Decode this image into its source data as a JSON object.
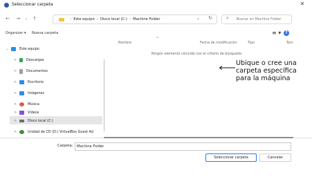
{
  "window": {
    "title": "Seleccionar carpeta"
  },
  "address_bar": {
    "crumbs": [
      "Este equipo",
      "Disco local (C:)",
      "Machine Folder"
    ]
  },
  "search": {
    "placeholder": "Buscar en Machine Folder"
  },
  "commands": {
    "organize": "Organizar ▾",
    "new_folder": "Nueva carpeta"
  },
  "sidebar": {
    "items": [
      {
        "label": "Este equipo",
        "chevron": "⌄",
        "icon": "computer-icon",
        "color": "#2b8ee6"
      },
      {
        "label": "Descargas",
        "chevron": ">",
        "icon": "download-icon",
        "color": "#2fa84f"
      },
      {
        "label": "Documentos",
        "chevron": ">",
        "icon": "document-icon",
        "color": "#9e9e9e"
      },
      {
        "label": "Escritorio",
        "chevron": ">",
        "icon": "desktop-icon",
        "color": "#2b8ee6"
      },
      {
        "label": "Imágenes",
        "chevron": ">",
        "icon": "pictures-icon",
        "color": "#2b8ee6"
      },
      {
        "label": "Música",
        "chevron": ">",
        "icon": "music-icon",
        "color": "#e8564a"
      },
      {
        "label": "Vídeos",
        "chevron": ">",
        "icon": "videos-icon",
        "color": "#8a4fd6"
      },
      {
        "label": "Disco local (C:)",
        "chevron": ">",
        "icon": "drive-icon",
        "color": "#6d6d6d"
      },
      {
        "label": "Unidad de CD (D:) VirtualBox Guest Ad",
        "chevron": ">",
        "icon": "cd-drive-icon",
        "color": "#4a8a3a"
      }
    ]
  },
  "columns": [
    "Nombre",
    "Fecha de modificación",
    "Tipo",
    "Tam"
  ],
  "file_list": {
    "empty_message": "Ningún elemento coincide con el criterio de búsqueda."
  },
  "annotation": {
    "text": "Ubique o cree una\ncarpeta específica\npara la máquina"
  },
  "footer": {
    "folder_label": "Carpeta:",
    "folder_value": "Machine Folder",
    "select_button": "Seleccionar carpeta",
    "cancel_button": "Cancelar"
  }
}
